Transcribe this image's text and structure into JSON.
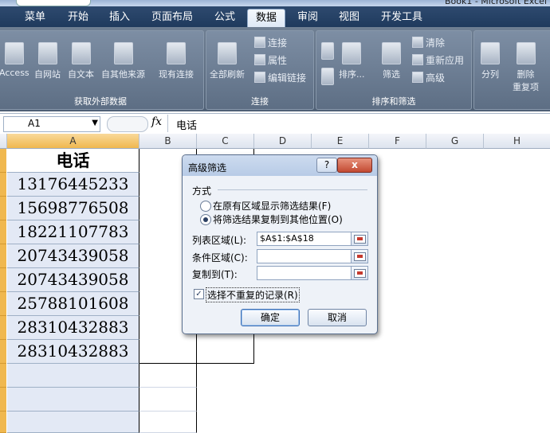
{
  "titlebar": {
    "text": "Book1 - Microsoft Excel"
  },
  "ribbon_tabs": [
    "菜单",
    "开始",
    "插入",
    "页面布局",
    "公式",
    "数据",
    "审阅",
    "视图",
    "开发工具"
  ],
  "active_tab": "数据",
  "ribbon": {
    "get_external": {
      "label": "获取外部数据",
      "buttons": [
        "Access",
        "自网站",
        "自文本",
        "自其他来源",
        "现有连接"
      ]
    },
    "connections": {
      "label": "连接",
      "refresh_all": "全部刷新",
      "small": [
        "连接",
        "属性",
        "编辑链接"
      ]
    },
    "sort_filter": {
      "label": "排序和筛选",
      "sort": "排序...",
      "filter": "筛选",
      "small": [
        "清除",
        "重新应用",
        "高级"
      ]
    },
    "data_tools": {
      "split": "分列",
      "delete": "删除",
      "duplicates": "重复项"
    }
  },
  "formula_bar": {
    "name_box": "A1",
    "fx": "fx",
    "content": "电话"
  },
  "columns": [
    "A",
    "B",
    "C",
    "D",
    "E",
    "F",
    "G",
    "H"
  ],
  "sheet": {
    "header": "电话",
    "values": [
      "13176445233",
      "15698776508",
      "18221107783",
      "20743439058",
      "20743439058",
      "25788101608",
      "28310432883",
      "28310432883"
    ]
  },
  "dialog": {
    "title": "高级筛选",
    "help": "?",
    "close": "x",
    "section": "方式",
    "option1": "在原有区域显示筛选结果(F)",
    "option2": "将筛选结果复制到其他位置(O)",
    "list_range_label": "列表区域(L):",
    "list_range_value": "$A$1:$A$18",
    "criteria_label": "条件区域(C):",
    "criteria_value": "",
    "copy_to_label": "复制到(T):",
    "copy_to_value": "",
    "unique_label": "选择不重复的记录(R)",
    "unique_checked": "✓",
    "ok": "确定",
    "cancel": "取消"
  }
}
